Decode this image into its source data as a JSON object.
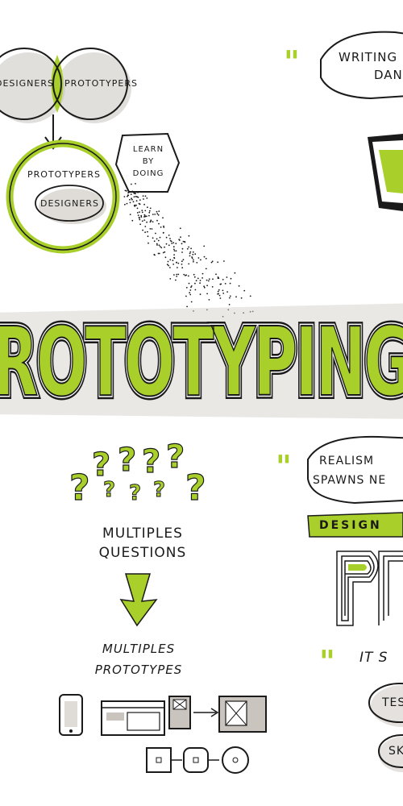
{
  "colors": {
    "accent": "#a8cf2a",
    "ink": "#1a1a1a",
    "grey": "#b9b4ad",
    "paper": "#ffffff"
  },
  "venn": {
    "left_label": "DESIGNERS",
    "right_label": "PROTOTYPERS"
  },
  "nested": {
    "outer_label": "PROTOTYPERS",
    "inner_label": "DESIGNERS"
  },
  "learn_by_doing": {
    "line1": "LEARN",
    "line2": "BY",
    "line3": "DOING"
  },
  "quote_top": {
    "line1": "WRITING",
    "line2": "DAN"
  },
  "big_word_top": "W",
  "banner": {
    "text": "ROTOTYPING"
  },
  "questions": {
    "line1": "MULTIPLES",
    "line2": "QUESTIONS"
  },
  "prototypes": {
    "line1": "MULTIPLES",
    "line2": "PROTOTYPES"
  },
  "quote_realism": {
    "line1": "REALISM",
    "line2": "SPAWNS NE"
  },
  "design_banner": "DESIGN",
  "big_word_pr": "PR",
  "quote_it": "IT S",
  "bubble_tes": "TES",
  "bubble_sk": "SK",
  "icons": [
    "phone-icon",
    "browser-window-icon",
    "small-screen-icon",
    "large-screen-icon",
    "flow-square-icon",
    "flow-rounded-icon",
    "flow-circle-icon"
  ]
}
